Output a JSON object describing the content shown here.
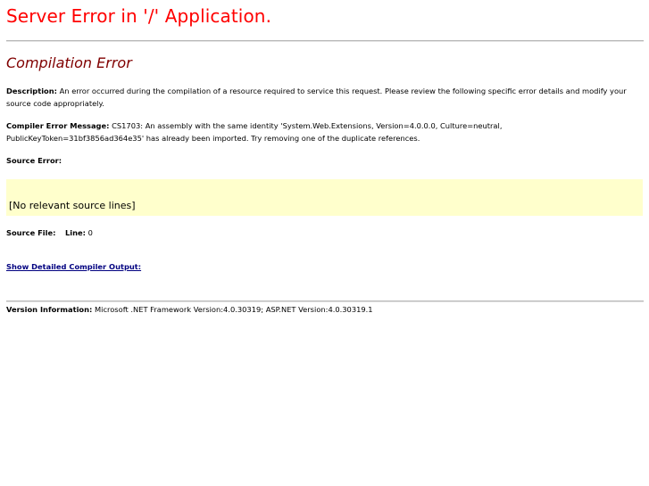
{
  "colors": {
    "title_red": "#ff0000",
    "subtitle_maroon": "#800000",
    "link_navy": "#000080",
    "source_box_bg": "#ffffcc"
  },
  "header": {
    "title": "Server Error in '/' Application."
  },
  "error": {
    "heading": "Compilation Error",
    "description_label": "Description:",
    "description_text": " An error occurred during the compilation of a resource required to service this request. Please review the following specific error details and modify your source code appropriately.",
    "compiler_message_label": "Compiler Error Message:",
    "compiler_message_text": " CS1703: An assembly with the same identity 'System.Web.Extensions, Version=4.0.0.0, Culture=neutral, PublicKeyToken=31bf3856ad364e35' has already been imported. Try removing one of the duplicate references.",
    "source_error_label": "Source Error:",
    "source_box_text": "[No relevant source lines]",
    "source_file_label": "Source File:",
    "line_label": "Line:",
    "line_value": " 0",
    "detail_link": "Show Detailed Compiler Output:"
  },
  "footer": {
    "version_label": "Version Information:",
    "version_text": " Microsoft .NET Framework Version:4.0.30319; ASP.NET Version:4.0.30319.1"
  }
}
